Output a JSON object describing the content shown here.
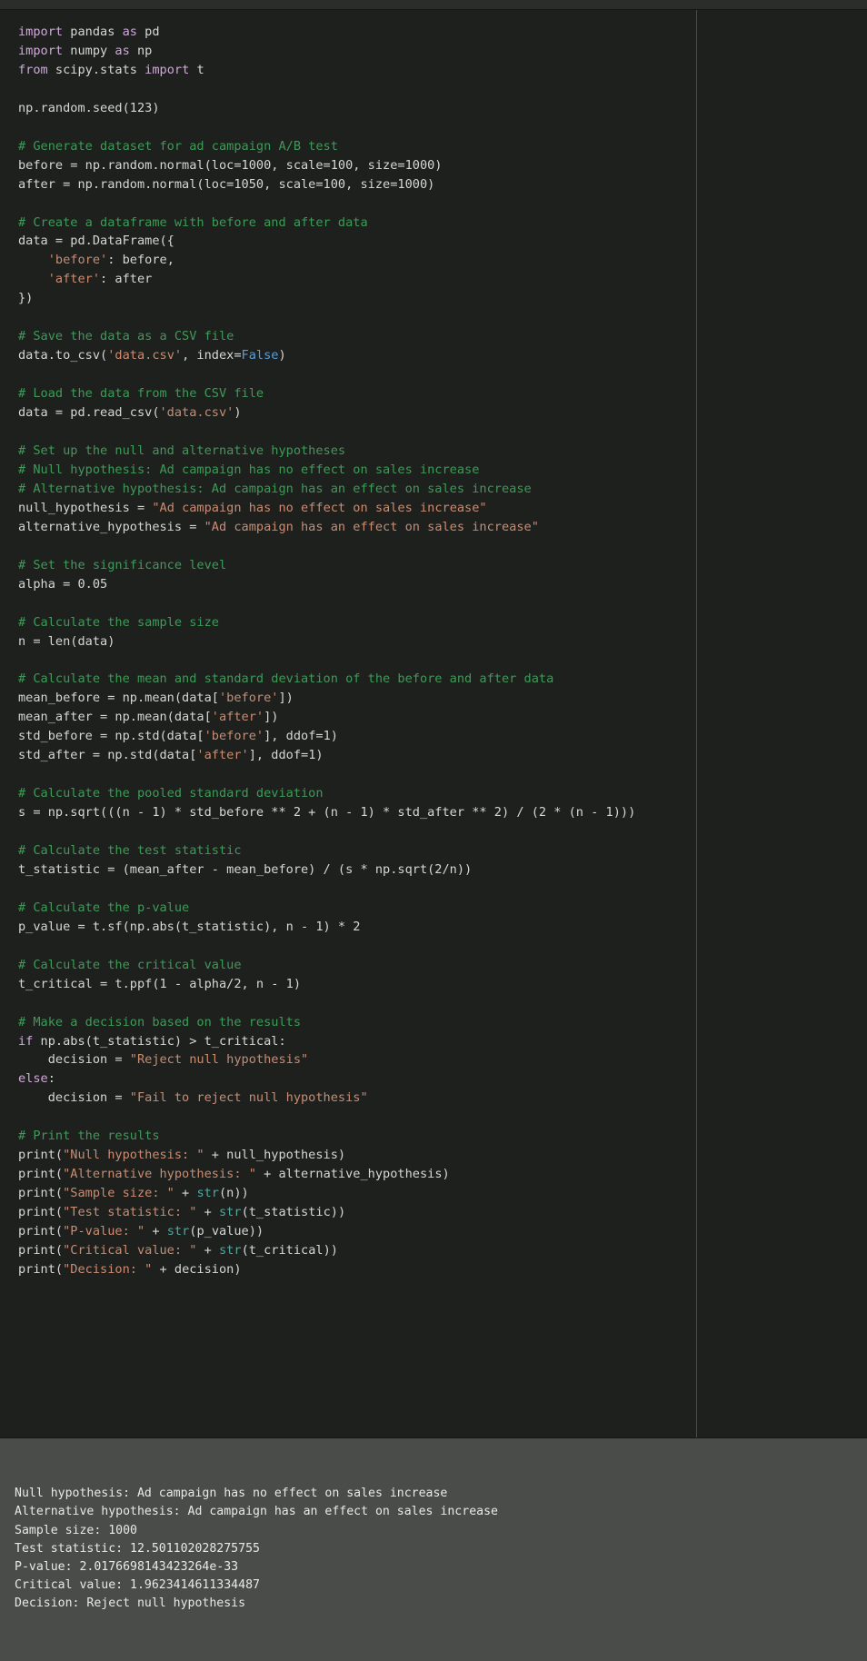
{
  "window": {
    "titlebar_label": ""
  },
  "editor": {
    "ruler_column": "80",
    "language": "python",
    "code_lines": [
      {
        "segments": [
          {
            "t": "import",
            "c": "kw"
          },
          {
            "t": " pandas ",
            "c": "pl"
          },
          {
            "t": "as",
            "c": "kw"
          },
          {
            "t": " pd",
            "c": "pl"
          }
        ]
      },
      {
        "segments": [
          {
            "t": "import",
            "c": "kw"
          },
          {
            "t": " numpy ",
            "c": "pl"
          },
          {
            "t": "as",
            "c": "kw"
          },
          {
            "t": " np",
            "c": "pl"
          }
        ]
      },
      {
        "segments": [
          {
            "t": "from",
            "c": "kw"
          },
          {
            "t": " scipy.stats ",
            "c": "pl"
          },
          {
            "t": "import",
            "c": "kw"
          },
          {
            "t": " t",
            "c": "pl"
          }
        ]
      },
      {
        "segments": []
      },
      {
        "segments": [
          {
            "t": "np.random.seed(123)",
            "c": "pl"
          }
        ]
      },
      {
        "segments": []
      },
      {
        "segments": [
          {
            "t": "# Generate dataset for ad campaign A/B test",
            "c": "cm"
          }
        ]
      },
      {
        "segments": [
          {
            "t": "before = np.random.normal(loc=1000, scale=100, size=1000)",
            "c": "pl"
          }
        ]
      },
      {
        "segments": [
          {
            "t": "after = np.random.normal(loc=1050, scale=100, size=1000)",
            "c": "pl"
          }
        ]
      },
      {
        "segments": []
      },
      {
        "segments": [
          {
            "t": "# Create a dataframe with before and after data",
            "c": "cm"
          }
        ]
      },
      {
        "segments": [
          {
            "t": "data = pd.DataFrame({",
            "c": "pl"
          }
        ]
      },
      {
        "segments": [
          {
            "t": "    ",
            "c": "pl"
          },
          {
            "t": "'before'",
            "c": "str"
          },
          {
            "t": ": before,",
            "c": "pl"
          }
        ]
      },
      {
        "segments": [
          {
            "t": "    ",
            "c": "pl"
          },
          {
            "t": "'after'",
            "c": "str"
          },
          {
            "t": ": after",
            "c": "pl"
          }
        ]
      },
      {
        "segments": [
          {
            "t": "})",
            "c": "pl"
          }
        ]
      },
      {
        "segments": []
      },
      {
        "segments": [
          {
            "t": "# Save the data as a CSV file",
            "c": "cm"
          }
        ]
      },
      {
        "segments": [
          {
            "t": "data.to_csv(",
            "c": "pl"
          },
          {
            "t": "'data.csv'",
            "c": "str"
          },
          {
            "t": ", index=",
            "c": "pl"
          },
          {
            "t": "False",
            "c": "bool"
          },
          {
            "t": ")",
            "c": "pl"
          }
        ]
      },
      {
        "segments": []
      },
      {
        "segments": [
          {
            "t": "# Load the data from the CSV file",
            "c": "cm"
          }
        ]
      },
      {
        "segments": [
          {
            "t": "data = pd.read_csv(",
            "c": "pl"
          },
          {
            "t": "'data.csv'",
            "c": "str"
          },
          {
            "t": ")",
            "c": "pl"
          }
        ]
      },
      {
        "segments": []
      },
      {
        "segments": [
          {
            "t": "# Set up the null and alternative hypotheses",
            "c": "cm"
          }
        ]
      },
      {
        "segments": [
          {
            "t": "# Null hypothesis: Ad campaign has no effect on sales increase",
            "c": "cm"
          }
        ]
      },
      {
        "segments": [
          {
            "t": "# Alternative hypothesis: Ad campaign has an effect on sales increase",
            "c": "cm"
          }
        ]
      },
      {
        "segments": [
          {
            "t": "null_hypothesis = ",
            "c": "pl"
          },
          {
            "t": "\"Ad campaign has no effect on sales increase\"",
            "c": "str"
          }
        ]
      },
      {
        "segments": [
          {
            "t": "alternative_hypothesis = ",
            "c": "pl"
          },
          {
            "t": "\"Ad campaign has an effect on sales increase\"",
            "c": "str"
          }
        ]
      },
      {
        "segments": []
      },
      {
        "segments": [
          {
            "t": "# Set the significance level",
            "c": "cm"
          }
        ]
      },
      {
        "segments": [
          {
            "t": "alpha = 0.05",
            "c": "pl"
          }
        ]
      },
      {
        "segments": []
      },
      {
        "segments": [
          {
            "t": "# Calculate the sample size",
            "c": "cm"
          }
        ]
      },
      {
        "segments": [
          {
            "t": "n = len(data)",
            "c": "pl"
          }
        ]
      },
      {
        "segments": []
      },
      {
        "segments": [
          {
            "t": "# Calculate the mean and standard deviation of the before and after data",
            "c": "cm"
          }
        ]
      },
      {
        "segments": [
          {
            "t": "mean_before = np.mean(data[",
            "c": "pl"
          },
          {
            "t": "'before'",
            "c": "str"
          },
          {
            "t": "])",
            "c": "pl"
          }
        ]
      },
      {
        "segments": [
          {
            "t": "mean_after = np.mean(data[",
            "c": "pl"
          },
          {
            "t": "'after'",
            "c": "str"
          },
          {
            "t": "])",
            "c": "pl"
          }
        ]
      },
      {
        "segments": [
          {
            "t": "std_before = np.std(data[",
            "c": "pl"
          },
          {
            "t": "'before'",
            "c": "str"
          },
          {
            "t": "], ddof=1)",
            "c": "pl"
          }
        ]
      },
      {
        "segments": [
          {
            "t": "std_after = np.std(data[",
            "c": "pl"
          },
          {
            "t": "'after'",
            "c": "str"
          },
          {
            "t": "], ddof=1)",
            "c": "pl"
          }
        ]
      },
      {
        "segments": []
      },
      {
        "segments": [
          {
            "t": "# Calculate the pooled standard deviation",
            "c": "cm"
          }
        ]
      },
      {
        "segments": [
          {
            "t": "s = np.sqrt(((n - 1) * std_before ** 2 + (n - 1) * std_after ** 2) / (2 * (n - 1)))",
            "c": "pl"
          }
        ]
      },
      {
        "segments": []
      },
      {
        "segments": [
          {
            "t": "# Calculate the test statistic",
            "c": "cm"
          }
        ]
      },
      {
        "segments": [
          {
            "t": "t_statistic = (mean_after - mean_before) / (s * np.sqrt(2/n))",
            "c": "pl"
          }
        ]
      },
      {
        "segments": []
      },
      {
        "segments": [
          {
            "t": "# Calculate the p-value",
            "c": "cm"
          }
        ]
      },
      {
        "segments": [
          {
            "t": "p_value = t.sf(np.abs(t_statistic), n - 1) * 2",
            "c": "pl"
          }
        ]
      },
      {
        "segments": []
      },
      {
        "segments": [
          {
            "t": "# Calculate the critical value",
            "c": "cm"
          }
        ]
      },
      {
        "segments": [
          {
            "t": "t_critical = t.ppf(1 - alpha/2, n - 1)",
            "c": "pl"
          }
        ]
      },
      {
        "segments": []
      },
      {
        "segments": [
          {
            "t": "# Make a decision based on the results",
            "c": "cm"
          }
        ]
      },
      {
        "segments": [
          {
            "t": "if",
            "c": "kw"
          },
          {
            "t": " np.abs(t_statistic) > t_critical:",
            "c": "pl"
          }
        ]
      },
      {
        "segments": [
          {
            "t": "    decision = ",
            "c": "pl"
          },
          {
            "t": "\"Reject null hypothesis\"",
            "c": "str"
          }
        ]
      },
      {
        "segments": [
          {
            "t": "else",
            "c": "kw"
          },
          {
            "t": ":",
            "c": "pl"
          }
        ]
      },
      {
        "segments": [
          {
            "t": "    decision = ",
            "c": "pl"
          },
          {
            "t": "\"Fail to reject null hypothesis\"",
            "c": "str"
          }
        ]
      },
      {
        "segments": []
      },
      {
        "segments": [
          {
            "t": "# Print the results",
            "c": "cm"
          }
        ]
      },
      {
        "segments": [
          {
            "t": "print(",
            "c": "pl"
          },
          {
            "t": "\"Null hypothesis: \"",
            "c": "str"
          },
          {
            "t": " + null_hypothesis)",
            "c": "pl"
          }
        ]
      },
      {
        "segments": [
          {
            "t": "print(",
            "c": "pl"
          },
          {
            "t": "\"Alternative hypothesis: \"",
            "c": "str"
          },
          {
            "t": " + alternative_hypothesis)",
            "c": "pl"
          }
        ]
      },
      {
        "segments": [
          {
            "t": "print(",
            "c": "pl"
          },
          {
            "t": "\"Sample size: \"",
            "c": "str"
          },
          {
            "t": " + ",
            "c": "pl"
          },
          {
            "t": "str",
            "c": "fn"
          },
          {
            "t": "(n))",
            "c": "pl"
          }
        ]
      },
      {
        "segments": [
          {
            "t": "print(",
            "c": "pl"
          },
          {
            "t": "\"Test statistic: \"",
            "c": "str"
          },
          {
            "t": " + ",
            "c": "pl"
          },
          {
            "t": "str",
            "c": "fn"
          },
          {
            "t": "(t_statistic))",
            "c": "pl"
          }
        ]
      },
      {
        "segments": [
          {
            "t": "print(",
            "c": "pl"
          },
          {
            "t": "\"P-value: \"",
            "c": "str"
          },
          {
            "t": " + ",
            "c": "pl"
          },
          {
            "t": "str",
            "c": "fn"
          },
          {
            "t": "(p_value))",
            "c": "pl"
          }
        ]
      },
      {
        "segments": [
          {
            "t": "print(",
            "c": "pl"
          },
          {
            "t": "\"Critical value: \"",
            "c": "str"
          },
          {
            "t": " + ",
            "c": "pl"
          },
          {
            "t": "str",
            "c": "fn"
          },
          {
            "t": "(t_critical))",
            "c": "pl"
          }
        ]
      },
      {
        "segments": [
          {
            "t": "print(",
            "c": "pl"
          },
          {
            "t": "\"Decision: \"",
            "c": "str"
          },
          {
            "t": " + decision)",
            "c": "pl"
          }
        ]
      }
    ]
  },
  "console": {
    "output_lines": [
      "Null hypothesis: Ad campaign has no effect on sales increase",
      "Alternative hypothesis: Ad campaign has an effect on sales increase",
      "Sample size: 1000",
      "Test statistic: 12.501102028275755",
      "P-value: 2.0176698143423264e-33",
      "Critical value: 1.9623414611334487",
      "Decision: Reject null hypothesis"
    ]
  },
  "colors": {
    "editor_background": "#1e201e",
    "console_background": "#4a4c4a",
    "titlebar_background": "#2b2d2b",
    "comment": "#3f9a58",
    "keyword": "#cfa9d8",
    "string": "#c98c72",
    "boolean": "#5b9dd9",
    "function": "#4ea8a0",
    "plain_text": "#d6d6d6",
    "ruler_line": "#4a4d4a"
  }
}
